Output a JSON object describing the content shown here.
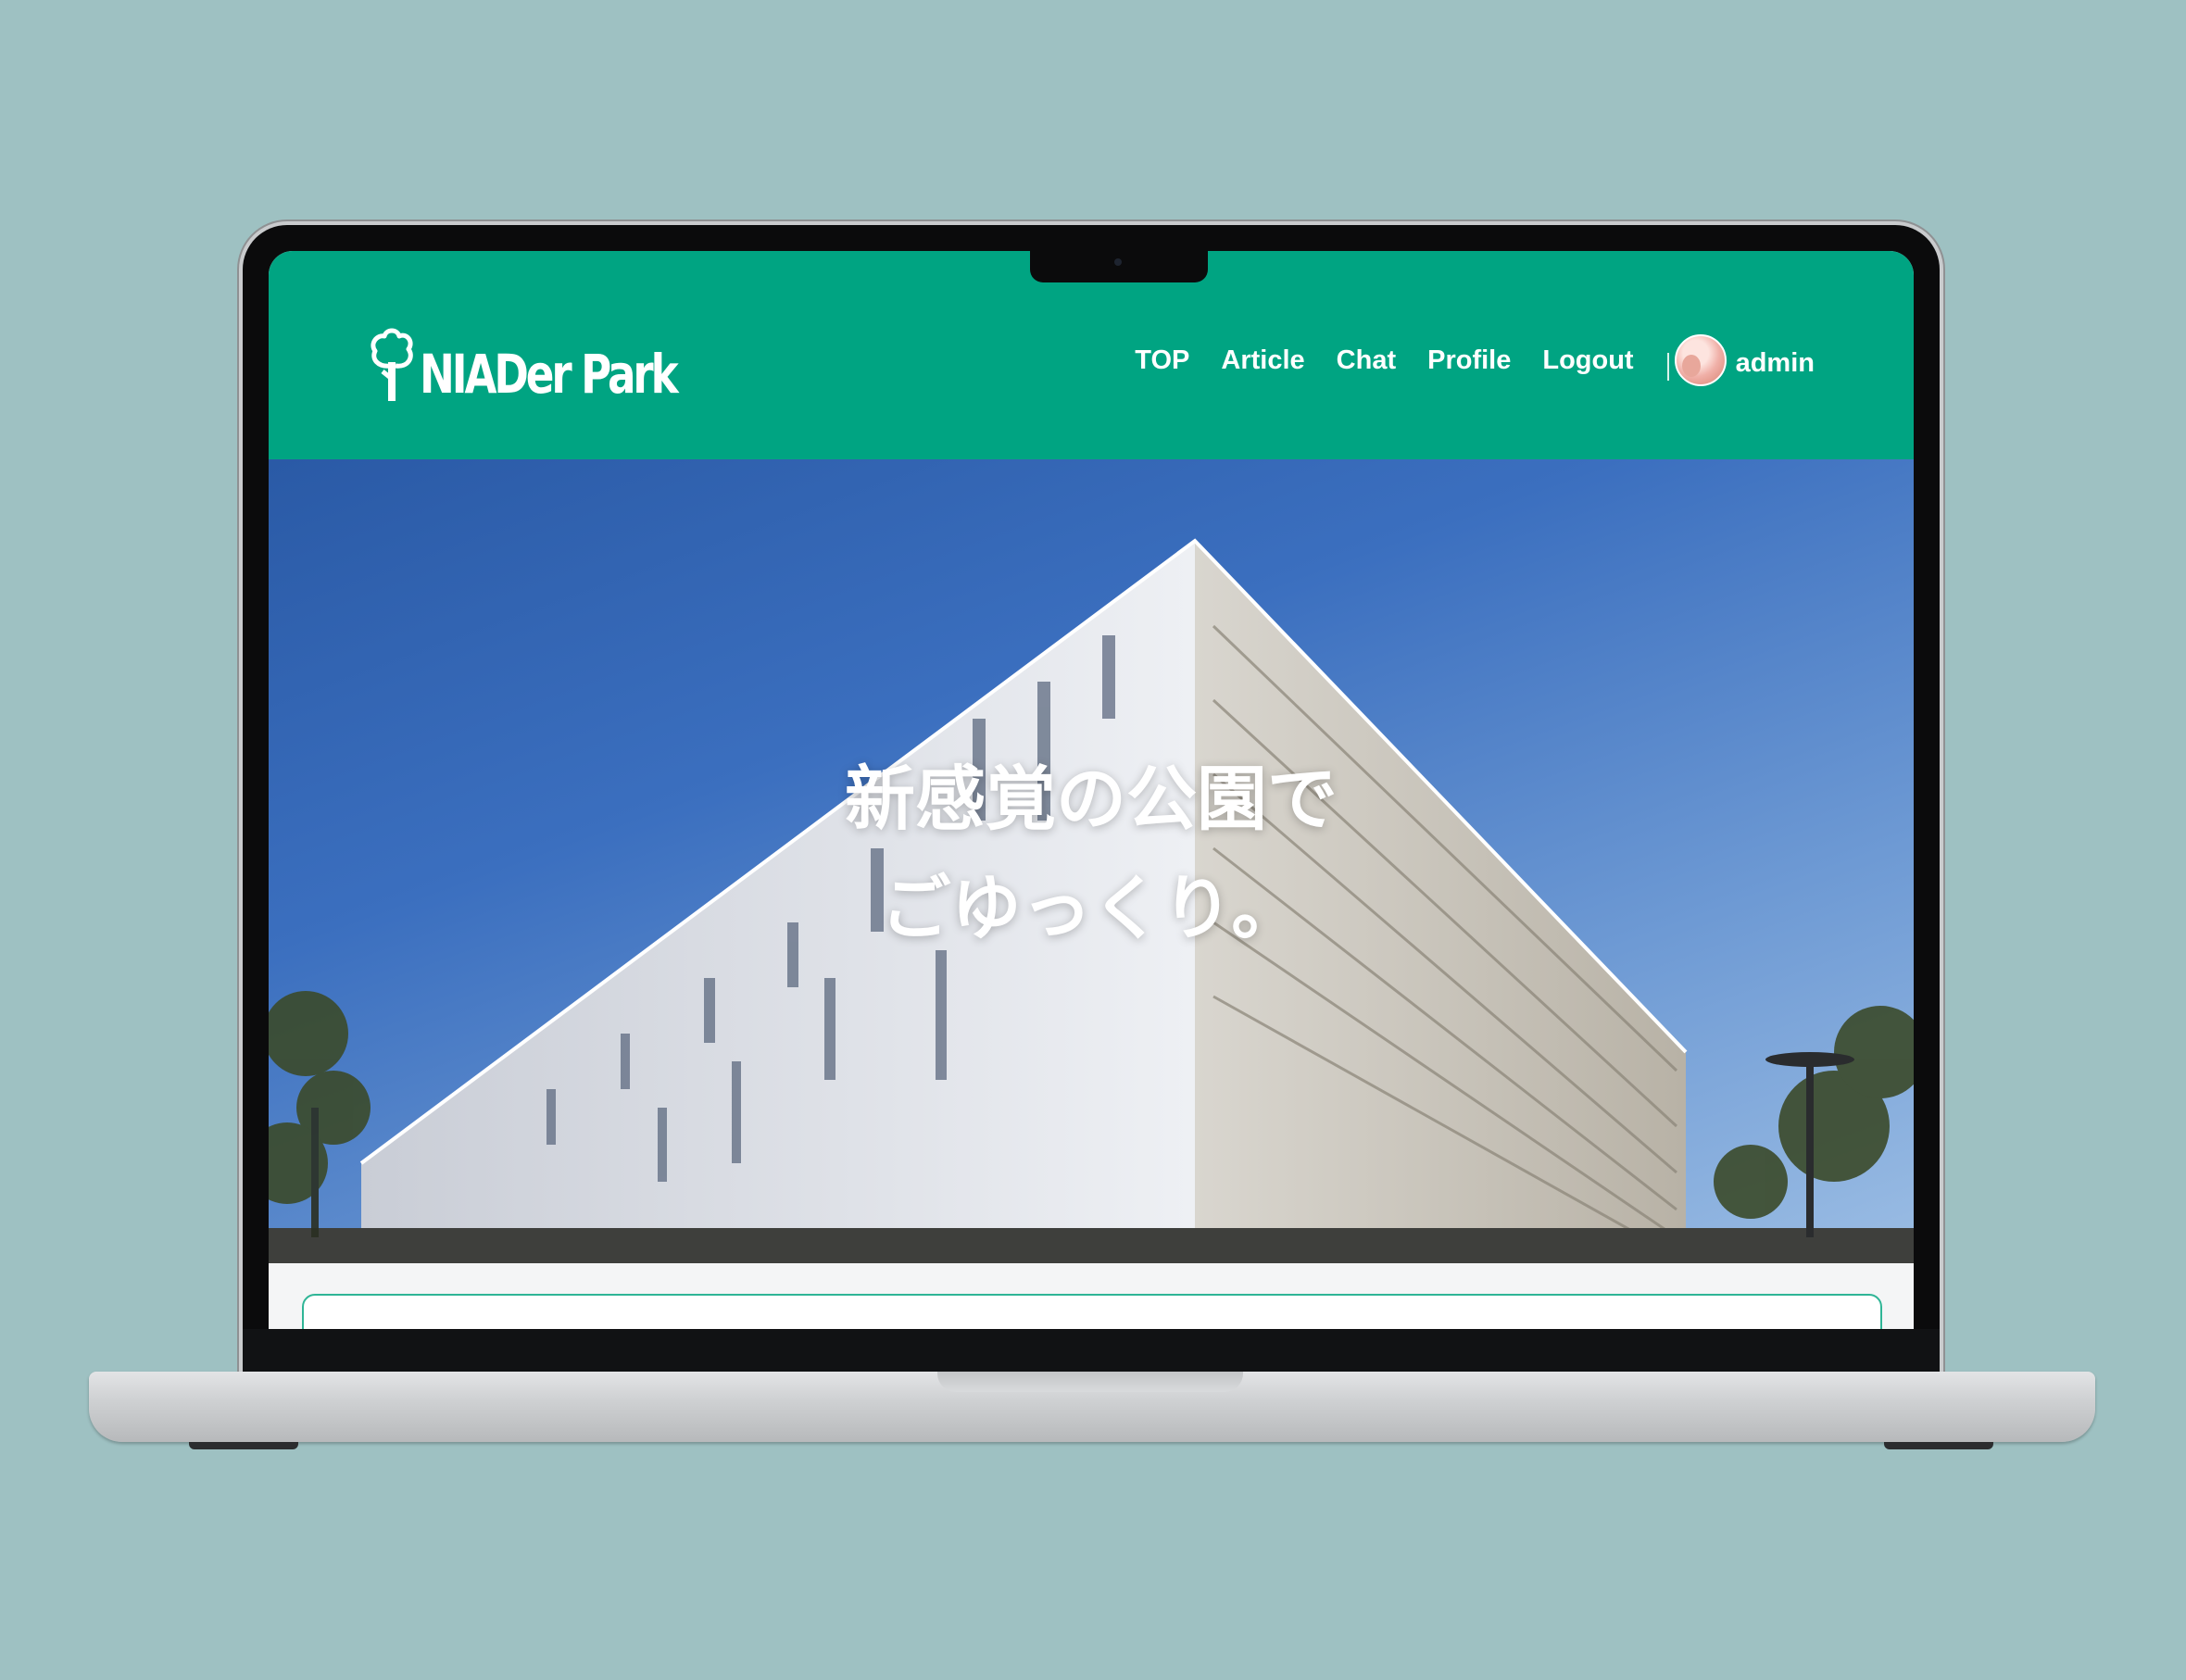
{
  "header": {
    "logo_text": "NIADer Park",
    "nav": [
      {
        "label": "TOP"
      },
      {
        "label": "Article"
      },
      {
        "label": "Chat"
      },
      {
        "label": "Profile"
      },
      {
        "label": "Logout"
      }
    ],
    "user": {
      "name": "admin"
    }
  },
  "hero": {
    "title_line1": "新感覚の公園で",
    "title_line2": "ごゆっくり。"
  },
  "colors": {
    "brand_green": "#00a482",
    "background": "#9ec1c2",
    "card_border": "#2fb596"
  }
}
